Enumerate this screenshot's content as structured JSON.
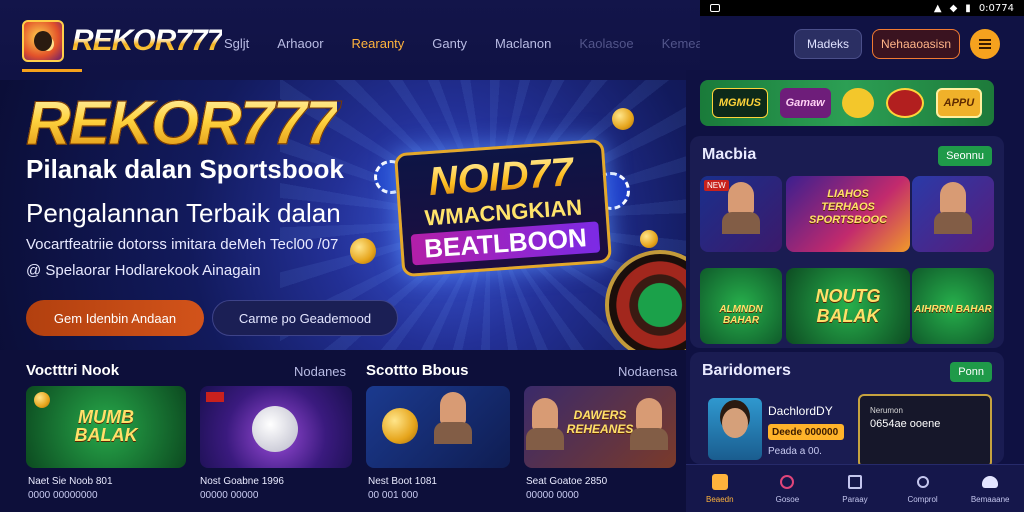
{
  "brand": {
    "name": "REKOR777"
  },
  "nav": {
    "items": [
      "Sgljt",
      "Arhaoor",
      "Rearanty",
      "Ganty",
      "Maclanon",
      "Kaolasoe",
      "Kemeasanu"
    ]
  },
  "status_bar": {
    "time": "0:0774"
  },
  "header_actions": {
    "login_label": "Madeks",
    "register_label": "Nehaaoasisn"
  },
  "hero": {
    "title": "REKOR777",
    "subtitle": "Pilanak dalan Sportsbook",
    "heading": "Pengalannan Terbaik dalan",
    "desc_line1": "Vocartfeatriie dotorss imitara deMeh Tecl00 /07",
    "desc_line2": "Spelaorar Hodlarekook Ainagain",
    "cta_primary": "Gem Idenbin Andaan",
    "cta_secondary": "Carme po Geademood",
    "art_line1": "NOID77",
    "art_line2": "WMACNGKIAN",
    "art_line3": "BEATLBOON"
  },
  "brand_strip": {
    "items": [
      "MGMUS",
      "Gamaw",
      "",
      "",
      "APPU"
    ]
  },
  "panel_games": {
    "title": "Macbia",
    "pill": "Seonnu",
    "tiles": [
      {
        "badge": "NEW",
        "label": ""
      },
      {
        "badge": "",
        "label": "LIAHOS TERHAOS SPORTSBOOC"
      },
      {
        "badge": "",
        "label": ""
      },
      {
        "badge": "",
        "label": "ALMNDN BAHAR"
      },
      {
        "badge": "",
        "label": "NOUTG BALAK"
      },
      {
        "badge": "",
        "label": "AIHRRN BAHAR"
      }
    ]
  },
  "panel_dash": {
    "title": "Baridomers",
    "pill": "Ponn",
    "name": "DachlordDY",
    "bar": "Deede 000000",
    "sub": "Peada a 00.",
    "card_line1": "Nerumon",
    "card_line2": "0654ae ooene"
  },
  "bottom_nav": {
    "items": [
      "Beaedn",
      "Gosoe",
      "Paraay",
      "Comprol",
      "Bemaaane"
    ]
  },
  "section_left": {
    "title": "Voctttri Nook",
    "link": "Nodanes",
    "cards": [
      {
        "label": "MUMB BALAK",
        "caption1": "Naet Sie Noob 801",
        "caption2": "0000 00000000"
      },
      {
        "label": "",
        "caption1": "Nost Goabne 1996",
        "caption2": "00000 00000"
      }
    ]
  },
  "section_right": {
    "title": "Scottto Bbous",
    "link": "Nodaensa",
    "cards": [
      {
        "label": "",
        "caption1": "Nest Boot 1081",
        "caption2": "00 001 000"
      },
      {
        "label": "DAWERS REHEANES",
        "caption1": "Seat Goatoe 2850",
        "caption2": "00000 0000"
      }
    ]
  },
  "colors": {
    "accent": "#f7a21b",
    "background": "#0d0f3a",
    "panel": "#1a1c52",
    "green": "#1f9a49"
  }
}
